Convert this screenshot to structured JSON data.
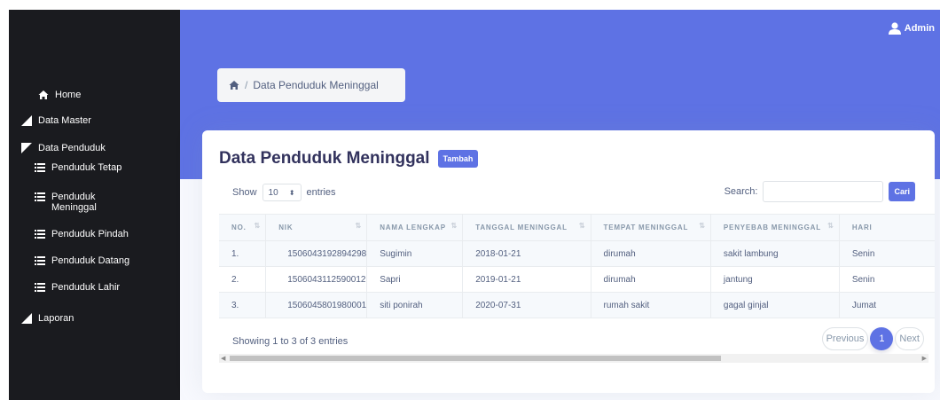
{
  "header": {
    "user_label": "Admin"
  },
  "sidebar": {
    "home": "Home",
    "data_master": "Data Master",
    "data_penduduk": "Data Penduduk",
    "sub": [
      "Penduduk Tetap",
      "Penduduk Meninggal",
      "Penduduk Pindah",
      "Penduduk Datang",
      "Penduduk Lahir"
    ],
    "laporan": "Laporan"
  },
  "breadcrumb": {
    "separator": "/",
    "current": "Data Penduduk Meninggal"
  },
  "card": {
    "title": "Data Penduduk Meninggal",
    "add_button": "Tambah",
    "show_label": "Show",
    "entries_value": "10",
    "entries_label": "entries",
    "search_label": "Search:",
    "search_value": "",
    "search_button": "Cari"
  },
  "table": {
    "columns": [
      "NO.",
      "NIK",
      "NAMA LENGKAP",
      "TANGGAL MENINGGAL",
      "TEMPAT MENINGGAL",
      "PENYEBAB MENINGGAL",
      "HARI"
    ],
    "rows": [
      [
        "1.",
        "1506043192894298",
        "Sugimin",
        "2018-01-21",
        "dirumah",
        "sakit lambung",
        "Senin"
      ],
      [
        "2.",
        "1506043112590012",
        "Sapri",
        "2019-01-21",
        "dirumah",
        "jantung",
        "Senin"
      ],
      [
        "3.",
        "1506045801980001",
        "siti ponirah",
        "2020-07-31",
        "rumah sakit",
        "gagal ginjal",
        "Jumat"
      ]
    ]
  },
  "footer": {
    "info": "Showing 1 to 3 of 3 entries",
    "previous": "Previous",
    "page": "1",
    "next": "Next"
  },
  "colors": {
    "primary": "#5e72e4",
    "sidebar": "#1a1b1f",
    "text": "#525f7f"
  },
  "icons": [
    "home-icon",
    "user-icon",
    "triangle-right-icon",
    "triangle-down-icon",
    "list-icon",
    "sort-icon"
  ]
}
